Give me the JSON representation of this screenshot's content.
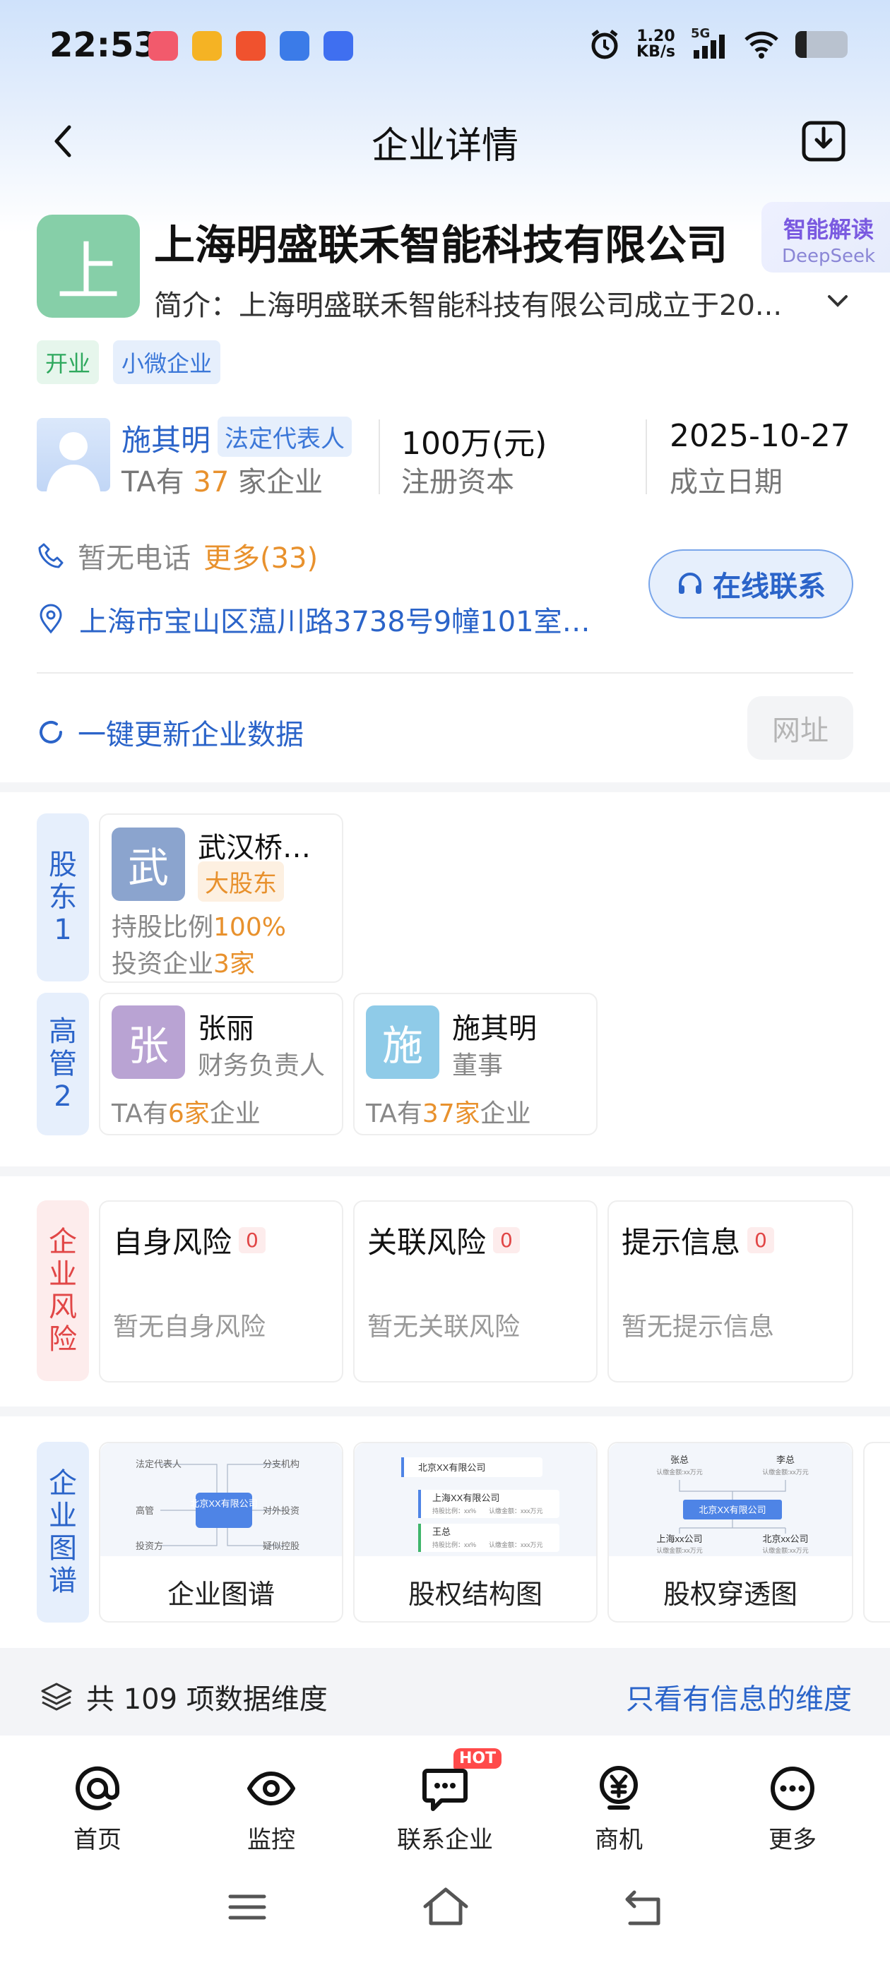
{
  "status_bar": {
    "time": "22:53",
    "net_speed_value": "1.20",
    "net_speed_unit": "KB/s",
    "signal": "5G"
  },
  "header": {
    "title": "企业详情"
  },
  "company": {
    "logo_char": "上",
    "name": "上海明盛联禾智能科技有限公司",
    "intro": "简介：上海明盛联禾智能科技有限公司成立于20...",
    "ai": {
      "title": "智能解读",
      "sub": "DeepSeek"
    },
    "tags": [
      "开业",
      "小微企业"
    ]
  },
  "legal_rep": {
    "name": "施其明",
    "badge": "法定代表人",
    "count_prefix": "TA有",
    "count": "37",
    "count_suffix": "家企业"
  },
  "capital": {
    "value": "100万(元)",
    "label": "注册资本"
  },
  "founded": {
    "value": "2025-10-27",
    "label": "成立日期"
  },
  "contact": {
    "phone": "暂无电话",
    "more": "更多(33)",
    "address": "上海市宝山区蕰川路3738号9幢101室…",
    "online_button": "在线联系"
  },
  "refresh": {
    "label": "一键更新企业数据",
    "website_button": "网址"
  },
  "shareholders": {
    "label_chars": [
      "股",
      "东",
      "1"
    ],
    "items": [
      {
        "avatar_char": "武",
        "name": "武汉桥…",
        "badge": "大股东",
        "ratio_label": "持股比例",
        "ratio_value": "100%",
        "invest_label": "投资企业",
        "invest_value": "3家"
      }
    ]
  },
  "executives": {
    "label_chars": [
      "高",
      "管",
      "2"
    ],
    "items": [
      {
        "avatar_char": "张",
        "name": "张丽",
        "role": "财务负责人",
        "prefix": "TA有",
        "count": "6家",
        "suffix": "企业"
      },
      {
        "avatar_char": "施",
        "name": "施其明",
        "role": "董事",
        "prefix": "TA有",
        "count": "37家",
        "suffix": "企业"
      }
    ]
  },
  "risk": {
    "label_chars": [
      "企",
      "业",
      "风",
      "险"
    ],
    "items": [
      {
        "title": "自身风险",
        "count": "0",
        "empty": "暂无自身风险"
      },
      {
        "title": "关联风险",
        "count": "0",
        "empty": "暂无关联风险"
      },
      {
        "title": "提示信息",
        "count": "0",
        "empty": "暂无提示信息"
      }
    ]
  },
  "graphs": {
    "label_chars": [
      "企",
      "业",
      "图",
      "谱"
    ],
    "items": [
      {
        "label": "企业图谱",
        "thumb": [
          "法定代表人",
          "分支机构",
          "高管",
          "北京XX有限公司",
          "对外投资",
          "投资方",
          "疑似控股"
        ]
      },
      {
        "label": "股权结构图",
        "thumb": [
          "北京XX有限公司",
          "上海XX有限公司",
          "持股比例：xx%",
          "认缴金额：xxx万元",
          "王总",
          "持股比例：xx%",
          "认缴金额：xxx万元"
        ]
      },
      {
        "label": "股权穿透图",
        "thumb": [
          "张总",
          "认缴金额:xx万元",
          "李总",
          "认缴金额:xx万元",
          "北京XX有限公司",
          "上海xx公司",
          "认缴金额:xx万元",
          "北京xx公司",
          "认缴金额:xx万元"
        ]
      }
    ]
  },
  "dimensions": {
    "left": "共 109 项数据维度",
    "right": "只看有信息的维度"
  },
  "bottom_nav": {
    "items": [
      {
        "label": "首页",
        "icon": "at-icon"
      },
      {
        "label": "监控",
        "icon": "eye-icon"
      },
      {
        "label": "联系企业",
        "icon": "chat-icon",
        "badge": "HOT"
      },
      {
        "label": "商机",
        "icon": "yen-icon"
      },
      {
        "label": "更多",
        "icon": "more-icon"
      }
    ]
  },
  "colors": {
    "accent_blue": "#2b64c9",
    "orange": "#e8912d",
    "red": "#e14646",
    "green_logo": "#86cfa8"
  }
}
